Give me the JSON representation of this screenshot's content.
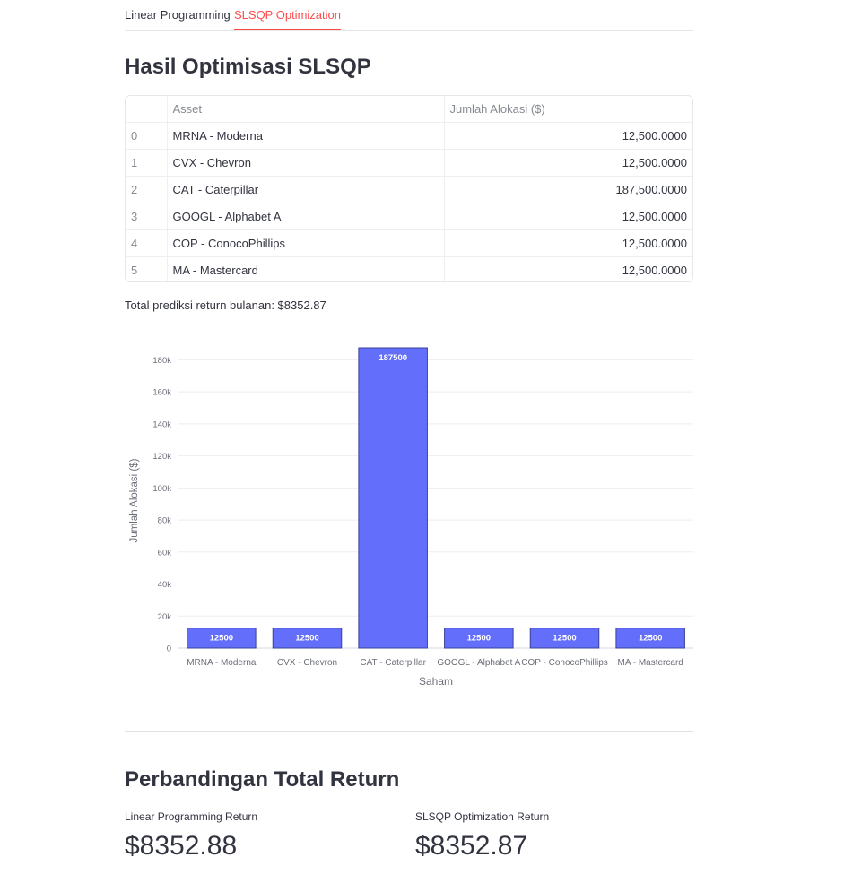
{
  "tabs": [
    {
      "label": "Linear Programming",
      "active": false
    },
    {
      "label": "SLSQP Optimization",
      "active": true
    }
  ],
  "title": "Hasil Optimisasi SLSQP",
  "table": {
    "columns": [
      "",
      "Asset",
      "Jumlah Alokasi ($)"
    ],
    "rows": [
      {
        "index": "0",
        "asset": "MRNA - Moderna",
        "amount": "12,500.0000"
      },
      {
        "index": "1",
        "asset": "CVX - Chevron",
        "amount": "12,500.0000"
      },
      {
        "index": "2",
        "asset": "CAT - Caterpillar",
        "amount": "187,500.0000"
      },
      {
        "index": "3",
        "asset": "GOOGL - Alphabet A",
        "amount": "12,500.0000"
      },
      {
        "index": "4",
        "asset": "COP - ConocoPhillips",
        "amount": "12,500.0000"
      },
      {
        "index": "5",
        "asset": "MA - Mastercard",
        "amount": "12,500.0000"
      }
    ]
  },
  "total_text": "Total prediksi return bulanan: $8352.87",
  "chart_data": {
    "type": "bar",
    "categories": [
      "MRNA - Moderna",
      "CVX - Chevron",
      "CAT - Caterpillar",
      "GOOGL - Alphabet A",
      "COP - ConocoPhillips",
      "MA - Mastercard"
    ],
    "values": [
      12500,
      12500,
      187500,
      12500,
      12500,
      12500
    ],
    "data_labels": [
      "12500",
      "12500",
      "187500",
      "12500",
      "12500",
      "12500"
    ],
    "xlabel": "Saham",
    "ylabel": "Jumlah Alokasi ($)",
    "ylim": [
      0,
      187500
    ],
    "yticks": [
      0,
      20000,
      40000,
      60000,
      80000,
      100000,
      120000,
      140000,
      160000,
      180000
    ],
    "ytick_labels": [
      "0",
      "20k",
      "40k",
      "60k",
      "80k",
      "100k",
      "120k",
      "140k",
      "160k",
      "180k"
    ],
    "grid": true,
    "bar_color": "#636efa",
    "bar_border_color": "#3b4199"
  },
  "comparison": {
    "title": "Perbandingan Total Return",
    "metrics": [
      {
        "label": "Linear Programming Return",
        "value": "$8352.88"
      },
      {
        "label": "SLSQP Optimization Return",
        "value": "$8352.87"
      }
    ]
  },
  "colors": {
    "accent": "#ff4b4b",
    "text": "#31333f",
    "muted": "#878a93"
  }
}
